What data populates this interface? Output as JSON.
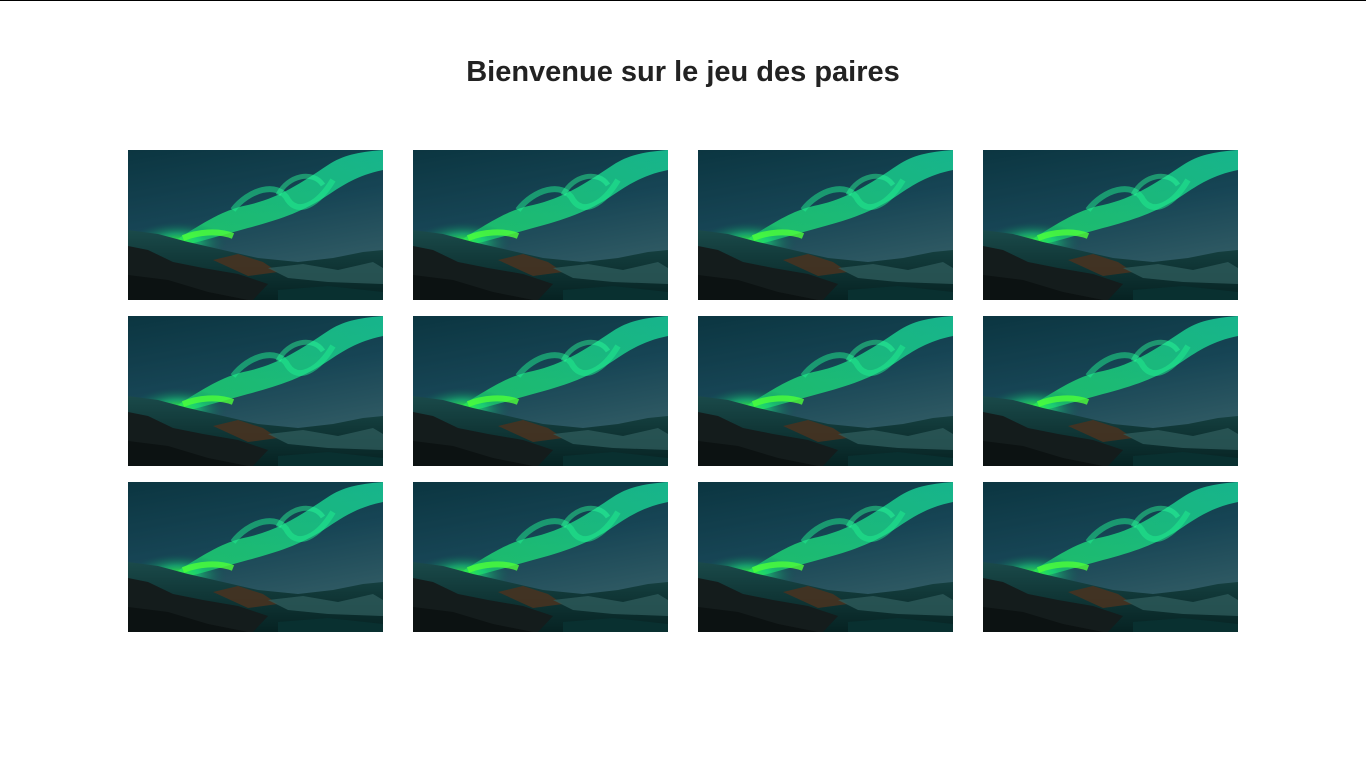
{
  "page": {
    "title": "Bienvenue sur le jeu des paires"
  },
  "cards": [
    {
      "image": "aurora-landscape",
      "state": "face-down"
    },
    {
      "image": "aurora-landscape",
      "state": "face-down"
    },
    {
      "image": "aurora-landscape",
      "state": "face-down"
    },
    {
      "image": "aurora-landscape",
      "state": "face-down"
    },
    {
      "image": "aurora-landscape",
      "state": "face-down"
    },
    {
      "image": "aurora-landscape",
      "state": "face-down"
    },
    {
      "image": "aurora-landscape",
      "state": "face-down"
    },
    {
      "image": "aurora-landscape",
      "state": "face-down"
    },
    {
      "image": "aurora-landscape",
      "state": "face-down"
    },
    {
      "image": "aurora-landscape",
      "state": "face-down"
    },
    {
      "image": "aurora-landscape",
      "state": "face-down"
    },
    {
      "image": "aurora-landscape",
      "state": "face-down"
    }
  ],
  "colors": {
    "sky_top": "#0b2740",
    "sky_bottom": "#3d5a6b",
    "aurora": "#19e67a",
    "aurora_core": "#2cff3a",
    "ground": "#0a2a2a"
  }
}
